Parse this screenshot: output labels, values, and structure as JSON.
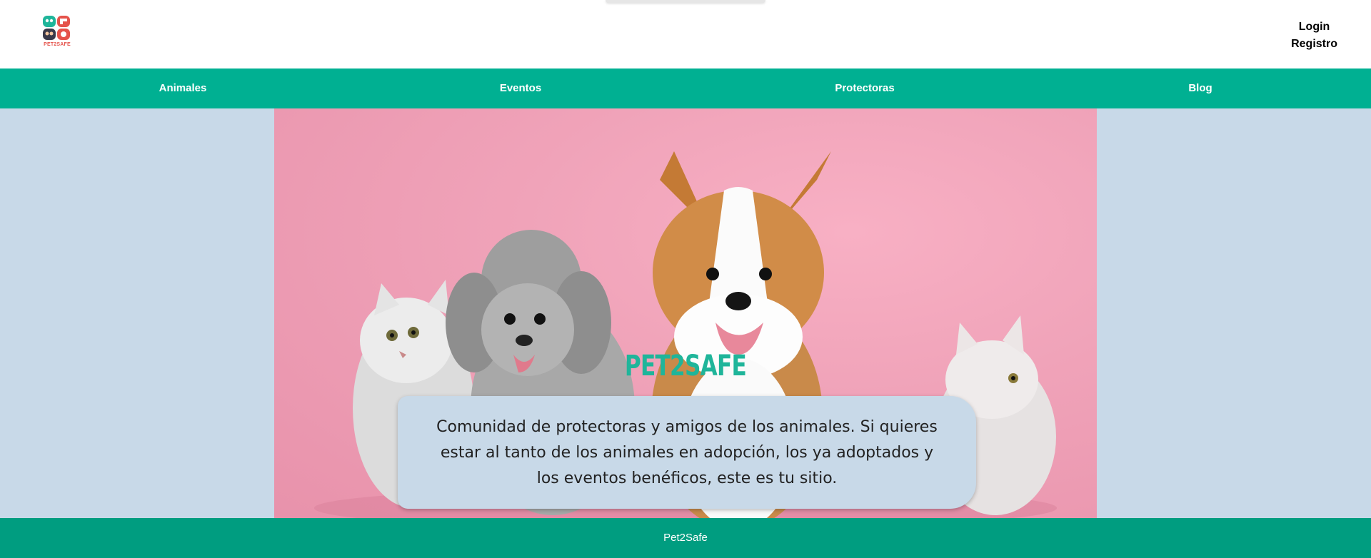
{
  "brand": {
    "logo_text": "PET2SAFE"
  },
  "auth": {
    "login": "Login",
    "register": "Registro"
  },
  "nav": [
    {
      "label": "Animales"
    },
    {
      "label": "Eventos"
    },
    {
      "label": "Protectoras"
    },
    {
      "label": "Blog"
    }
  ],
  "hero": {
    "title": "PET2SAFE",
    "description": "Comunidad de protectoras y amigos de los animales. Si quieres estar al tanto de los animales en adopción, los ya adoptados y los eventos benéficos, este es tu sitio."
  },
  "footer": {
    "text": "Pet2Safe"
  },
  "colors": {
    "nav": "#00b092",
    "footer": "#009d80",
    "background": "#c8d9e8",
    "title": "#1fb59a",
    "logo_text": "#e5534b"
  }
}
